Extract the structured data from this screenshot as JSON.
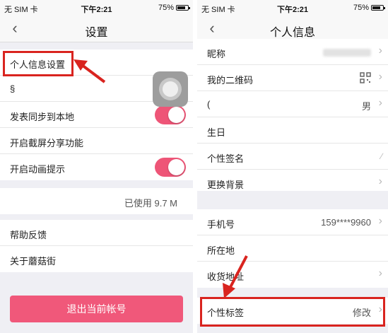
{
  "left": {
    "status": {
      "carrier": "无 SIM 卡",
      "time": "下午2:21",
      "battery": "75%"
    },
    "nav": {
      "back_icon": "‹",
      "title": "设置"
    },
    "items": {
      "personal_info": "个人信息设置",
      "partial": "§",
      "sync": "发表同步到本地",
      "screenshot_share": "开启截屏分享功能",
      "animation_hint": "开启动画提示"
    },
    "cache": {
      "used": "已使用 9.7 M"
    },
    "help": "帮助反馈",
    "about": "关于蘑菇街",
    "logout": "退出当前帐号"
  },
  "right": {
    "status": {
      "carrier": "无 SIM 卡",
      "time": "下午2:21",
      "battery": "75%"
    },
    "nav": {
      "back_icon": "‹",
      "title": "个人信息"
    },
    "rows": {
      "nickname": "昵称",
      "qr": "我的二维码",
      "gender_label": "(",
      "gender_value": "男",
      "birthday": "生日",
      "signature": "个性签名",
      "background": "更换背景",
      "phone": "手机号",
      "phone_value": "159****9960",
      "location": "所在地",
      "address": "收货地址",
      "tags": "个性标签",
      "tags_value": "修改"
    },
    "chevron": "›"
  },
  "colors": {
    "accent": "#f0587a",
    "highlight": "#d9241f"
  }
}
